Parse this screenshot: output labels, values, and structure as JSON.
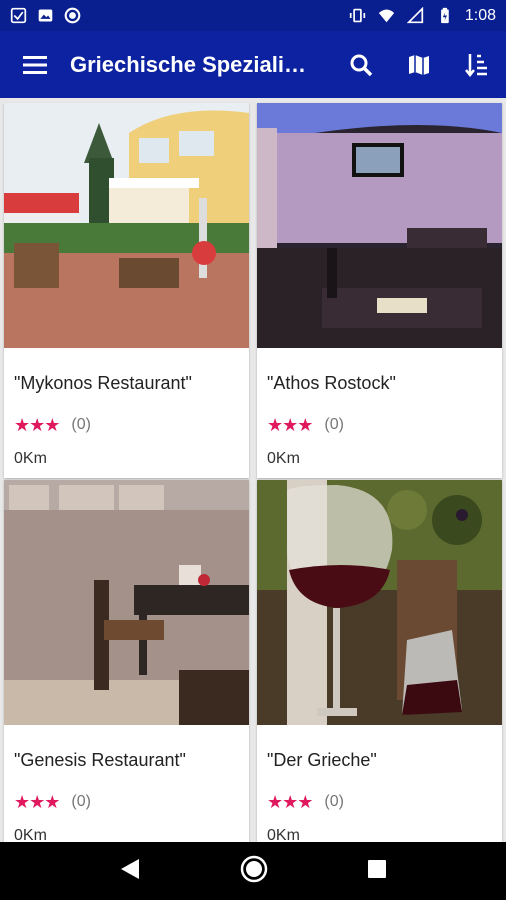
{
  "status_bar": {
    "time": "1:08",
    "left_icons": [
      "clipboard-check-icon",
      "photo-icon",
      "circle-icon"
    ],
    "right_icons": [
      "vibrate-icon",
      "wifi-icon",
      "signal-icon",
      "battery-icon"
    ]
  },
  "app_bar": {
    "title": "Griechische Spezialitäten",
    "actions": [
      "search-icon",
      "map-icon",
      "sort-icon"
    ]
  },
  "restaurants": [
    {
      "name": "\"Mykonos Restaurant\"",
      "stars": "★★★",
      "count": "(0)",
      "distance": "0Km",
      "photo": "restaurant-exterior-terrace"
    },
    {
      "name": "\"Athos Rostock\"",
      "stars": "★★★",
      "count": "(0)",
      "distance": "0Km",
      "photo": "dining-room-blue-light"
    },
    {
      "name": "\"Genesis Restaurant\"",
      "stars": "★★★",
      "count": "(0)",
      "distance": "0Km",
      "photo": "dining-tables-interior"
    },
    {
      "name": "\"Der Grieche\"",
      "stars": "★★★",
      "count": "(0)",
      "distance": "0Km",
      "photo": "red-wine-glass-carafe"
    }
  ],
  "nav_bar": [
    "back-icon",
    "home-icon",
    "recents-icon"
  ],
  "colors": {
    "status_bar": "#0a1f8f",
    "app_bar": "#0d22a0",
    "star": "#e0195e"
  }
}
